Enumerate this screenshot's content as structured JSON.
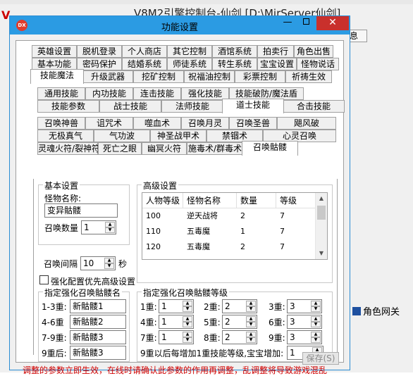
{
  "background": {
    "app_title": "V8M2引擎控制台-仙剑 [D:\\MirServer仙剑]",
    "right_tab_label": "息",
    "right_item_label": "角色网关"
  },
  "dialog": {
    "title": "功能设置",
    "titlebar_buttons": {
      "minimize": "—",
      "close": "✕"
    },
    "tabs_row1": [
      "英雄设置",
      "脱机登录",
      "个人商店",
      "其它控制",
      "酒馆系统",
      "拍卖行",
      "角色出售"
    ],
    "tabs_row2": [
      "基本功能",
      "密码保护",
      "结婚系统",
      "师徒系统",
      "转生系统",
      "宝宝设置",
      "怪物说话"
    ],
    "tabs_row3": [
      "技能魔法",
      "升级武器",
      "挖矿控制",
      "祝福油控制",
      "彩票控制",
      "祈祷生效"
    ],
    "tabs_row4": [
      "通用技能",
      "内功技能",
      "连击技能",
      "强化技能",
      "技能破防/魔法盾"
    ],
    "tabs_row5": [
      "技能参数",
      "战士技能",
      "法师技能",
      "道士技能",
      "合击技能"
    ],
    "tabs_row6": [
      "召唤神兽",
      "诅咒术",
      "噬血术",
      "召唤月灵",
      "召唤圣兽",
      "飓风破"
    ],
    "tabs_row7": [
      "无极真气",
      "气功波",
      "神圣战甲术",
      "禁锢术",
      "心灵召唤"
    ],
    "tabs_row8": [
      "灵魂火符/裂神符",
      "死亡之眼",
      "幽冥火符",
      "施毒术/群毒术",
      "召唤骷髅"
    ],
    "active": {
      "row3": "技能魔法",
      "row5": "道士技能",
      "row8": "召唤骷髅"
    },
    "basic": {
      "group_label": "基本设置",
      "monster_name_label": "怪物名称:",
      "monster_name_value": "变异骷髅",
      "summon_count_label": "召唤数量",
      "summon_count_value": "1",
      "summon_interval_label": "召唤间隔",
      "summon_interval_value": "10",
      "summon_interval_unit": "秒"
    },
    "advanced": {
      "group_label": "高级设置",
      "columns": [
        "人物等级",
        "怪物名称",
        "数量",
        "等级"
      ],
      "rows": [
        [
          "100",
          "逆天战将",
          "2",
          "7"
        ],
        [
          "110",
          "五毒魔",
          "1",
          "7"
        ],
        [
          "120",
          "五毒魔",
          "2",
          "7"
        ]
      ]
    },
    "priority_checkbox_label": "强化配置优先高级设置",
    "strong_names": {
      "group_label": "指定强化召唤骷髅名",
      "items": [
        {
          "label": "1-3重:",
          "value": "新骷髅1"
        },
        {
          "label": "4-6重",
          "value": "新骷髅2"
        },
        {
          "label": "7-9重:",
          "value": "新骷髅3"
        },
        {
          "label": "9重后:",
          "value": "新骷髅3"
        }
      ]
    },
    "strong_levels": {
      "group_label": "指定强化召唤骷髅等级",
      "items": [
        {
          "label": "1重:",
          "value": "1"
        },
        {
          "label": "2重:",
          "value": "2"
        },
        {
          "label": "3重:",
          "value": "3"
        },
        {
          "label": "4重:",
          "value": "1"
        },
        {
          "label": "5重:",
          "value": "2"
        },
        {
          "label": "6重:",
          "value": "3"
        },
        {
          "label": "7重:",
          "value": "1"
        },
        {
          "label": "8重:",
          "value": "2"
        },
        {
          "label": "9重:",
          "value": "3"
        }
      ],
      "extra_label": "9重以后每增加1重技能等级,宝宝增加:",
      "extra_value": "1"
    },
    "save_button": "保存(S)",
    "warning": "调整的参数立即生效，在线时请确认此参数的作用再调整，乱调整将导致游戏混乱"
  }
}
